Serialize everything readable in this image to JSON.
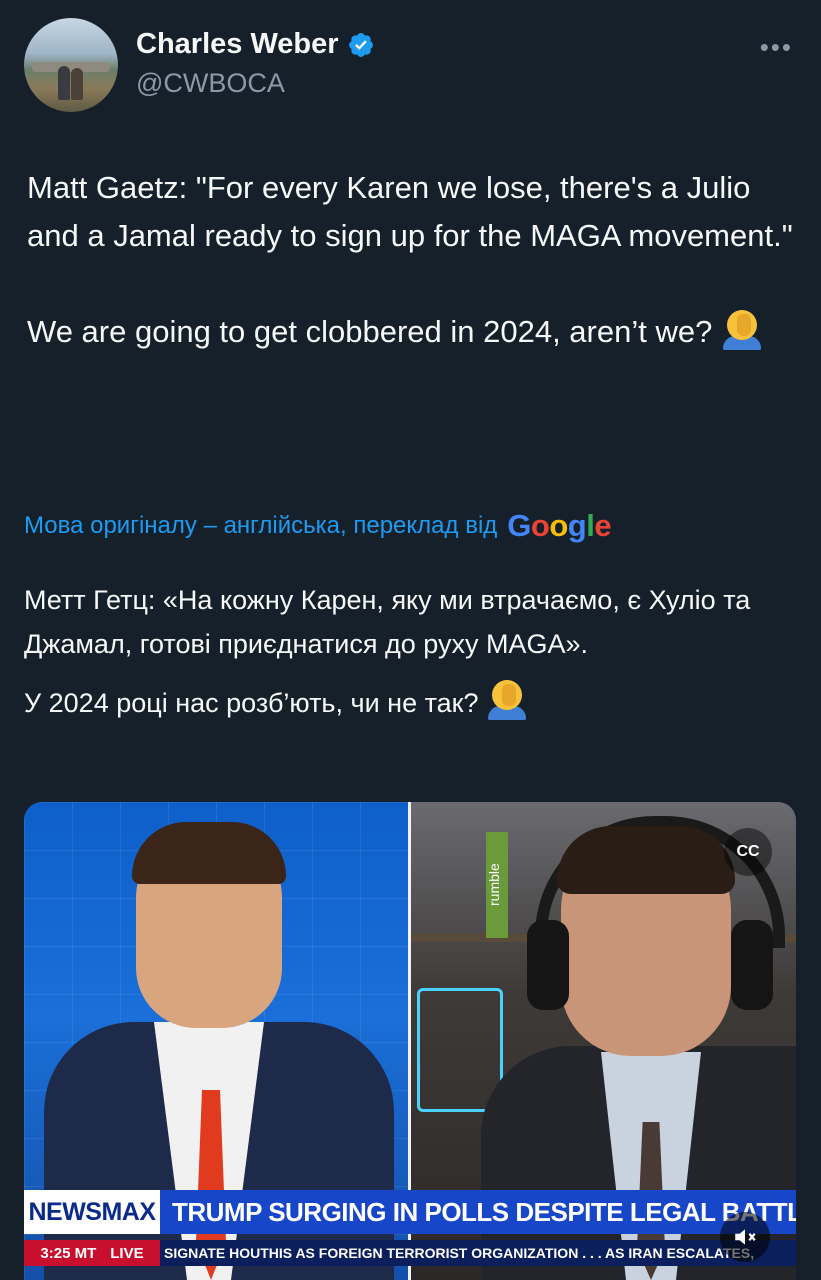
{
  "author": {
    "display_name": "Charles Weber",
    "handle": "@CWBOCA",
    "verified": true
  },
  "more_icon": "more-horizontal-icon",
  "tweet": {
    "paragraph1": "Matt Gaetz: \"For every Karen we lose, there's a Julio and a Jamal ready to sign up for the MAGA movement.\"",
    "paragraph2": "We are going to get clobbered in 2024, aren’t we?"
  },
  "translation": {
    "note": "Мова оригіналу – англійська, переклад від",
    "provider_letters": [
      "G",
      "o",
      "o",
      "g",
      "l",
      "e"
    ],
    "paragraph1": "Метт Гетц: «На кожну Карен, яку ми втрачаємо, є Хуліо та Джамал, готові приєднатися до руху MAGA».",
    "paragraph2": "У 2024 році нас розб’ють, чи не так?"
  },
  "media": {
    "chyron_brand": "NEWSMAX",
    "chyron_headline": "TRUMP SURGING IN POLLS DESPITE LEGAL BATTLES",
    "chyron_time": "3:25 MT",
    "chyron_live": "LIVE",
    "chyron_ticker": "SIGNATE HOUTHIS AS FOREIGN TERRORIST ORGANIZATION . . .     AS IRAN ESCALATES,",
    "rumble_label": "rumble",
    "cc_label": "CC",
    "mute_icon": "speaker-muted-icon"
  },
  "colors": {
    "background": "#15202b",
    "accent": "#1d9bf0",
    "secondary_text": "#8b98a5"
  }
}
